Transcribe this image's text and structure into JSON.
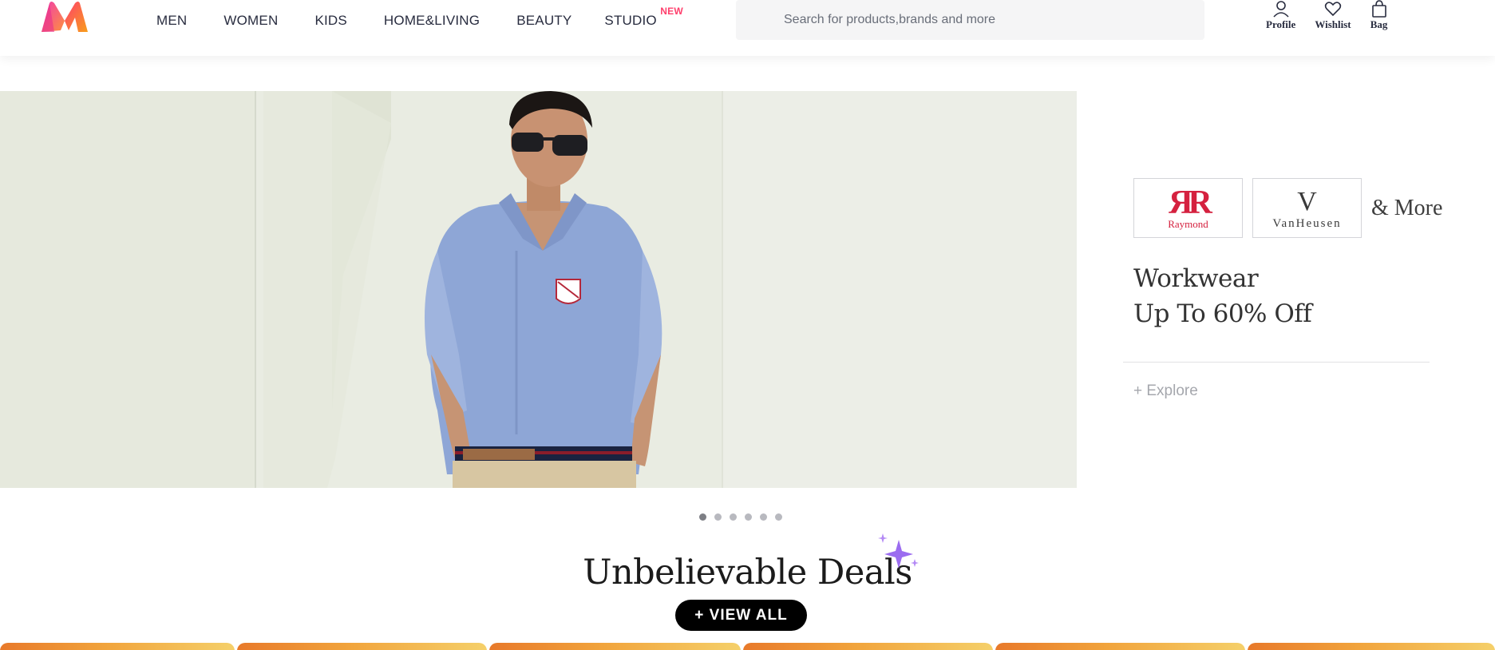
{
  "header": {
    "nav": [
      {
        "label": "MEN"
      },
      {
        "label": "WOMEN"
      },
      {
        "label": "KIDS"
      },
      {
        "label": "HOME&LIVING"
      },
      {
        "label": "BEAUTY"
      },
      {
        "label": "STUDIO",
        "tag": "NEW"
      }
    ],
    "search": {
      "placeholder": "Search for products,brands and more"
    },
    "actions": [
      {
        "label": "Profile",
        "icon": "profile-icon"
      },
      {
        "label": "Wishlist",
        "icon": "heart-icon"
      },
      {
        "label": "Bag",
        "icon": "bag-icon"
      }
    ]
  },
  "hero": {
    "brands": [
      {
        "mark": "ЯR",
        "name": "Raymond"
      },
      {
        "mark": "V",
        "name": "VanHeusen"
      }
    ],
    "more": "& More",
    "promo_line1": "Workwear",
    "promo_line2": "Up To 60% Off",
    "explore": "+ Explore",
    "slides_count": 6,
    "active_slide": 1
  },
  "deals": {
    "title": "Unbelievable Deals",
    "view_all": "+ VIEW ALL"
  },
  "colors": {
    "accent": "#ff3f6c",
    "text": "#282c3f",
    "logo_pink": "#ff3f6c",
    "logo_orange": "#f89e1b"
  }
}
